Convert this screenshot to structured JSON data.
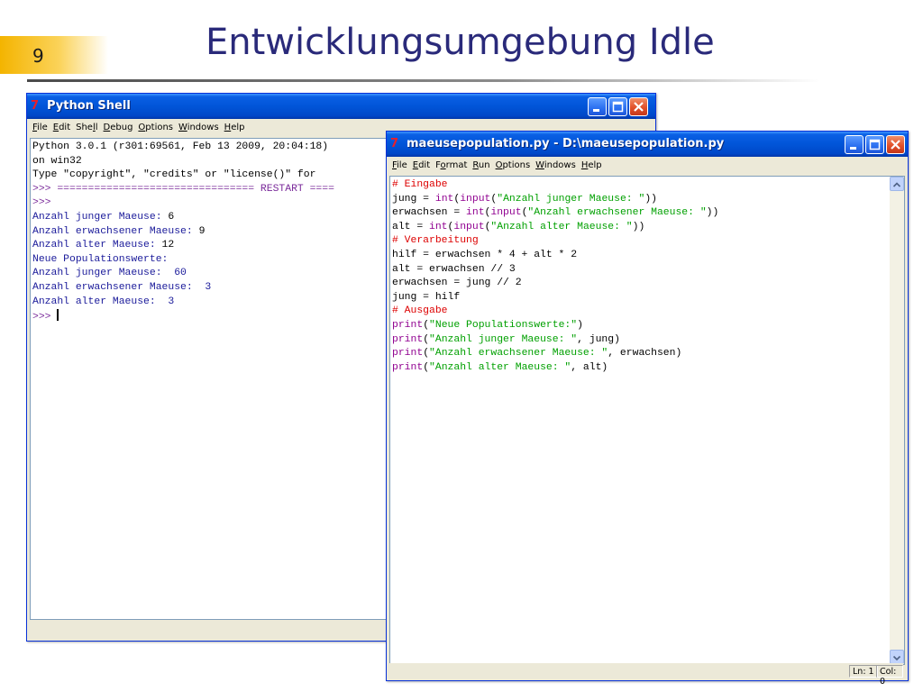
{
  "slide": {
    "number": "9",
    "title": "Entwicklungsumgebung Idle"
  },
  "shell_window": {
    "title": "Python Shell",
    "menu": [
      {
        "mn": "F",
        "rest": "ile"
      },
      {
        "mn": "E",
        "rest": "dit"
      },
      {
        "mn": "",
        "pre": "She",
        "mn2": "l",
        "rest": "l"
      },
      {
        "mn": "D",
        "rest": "ebug"
      },
      {
        "mn": "O",
        "rest": "ptions"
      },
      {
        "mn": "W",
        "rest": "indows"
      },
      {
        "mn": "H",
        "rest": "elp"
      }
    ],
    "lines": [
      "Python 3.0.1 (r301:69561, Feb 13 2009, 20:04:18)",
      "on win32",
      "Type \"copyright\", \"credits\" or \"license()\" for",
      ">>> ================================ RESTART ====",
      ">>>",
      "Anzahl junger Maeuse: ",
      "Anzahl erwachsener Maeuse: ",
      "Anzahl alter Maeuse: ",
      "Neue Populationswerte:",
      "Anzahl junger Maeuse:  60",
      "Anzahl erwachsener Maeuse:  3",
      "Anzahl alter Maeuse:  3",
      ">>> "
    ],
    "inputs": [
      "6",
      "9",
      "12"
    ]
  },
  "editor_window": {
    "title": "maeusepopulation.py - D:\\maeusepopulation.py",
    "menu": [
      "File",
      "Edit",
      "Format",
      "Run",
      "Options",
      "Windows",
      "Help"
    ],
    "code": {
      "l1": "# Eingabe",
      "l2a": "jung = ",
      "l2b": "int",
      "l2c": "(",
      "l2d": "input",
      "l2e": "(",
      "l2f": "\"Anzahl junger Maeuse: \"",
      "l2g": "))",
      "l3a": "erwachsen = ",
      "l3b": "int",
      "l3c": "(",
      "l3d": "input",
      "l3e": "(",
      "l3f": "\"Anzahl erwachsener Maeuse: \"",
      "l3g": "))",
      "l4a": "alt = ",
      "l4b": "int",
      "l4c": "(",
      "l4d": "input",
      "l4e": "(",
      "l4f": "\"Anzahl alter Maeuse: \"",
      "l4g": "))",
      "l5": "# Verarbeitung",
      "l6": "hilf = erwachsen * 4 + alt * 2",
      "l7": "alt = erwachsen // 3",
      "l8": "erwachsen = jung // 2",
      "l9": "jung = hilf",
      "l10": "# Ausgabe",
      "l11a": "print",
      "l11b": "(",
      "l11c": "\"Neue Populationswerte:\"",
      "l11d": ")",
      "l12a": "print",
      "l12b": "(",
      "l12c": "\"Anzahl junger Maeuse: \"",
      "l12d": ", jung)",
      "l13a": "print",
      "l13b": "(",
      "l13c": "\"Anzahl erwachsener Maeuse: \"",
      "l13d": ", erwachsen)",
      "l14a": "print",
      "l14b": "(",
      "l14c": "\"Anzahl alter Maeuse: \"",
      "l14d": ", alt)"
    },
    "status": {
      "line": "Ln: 1",
      "col": "Col: 0"
    }
  },
  "colors": {
    "titlebar": "#0155d8",
    "comment": "#dd0000",
    "builtin": "#900090",
    "string": "#00a000",
    "output": "#1a1a9a"
  }
}
